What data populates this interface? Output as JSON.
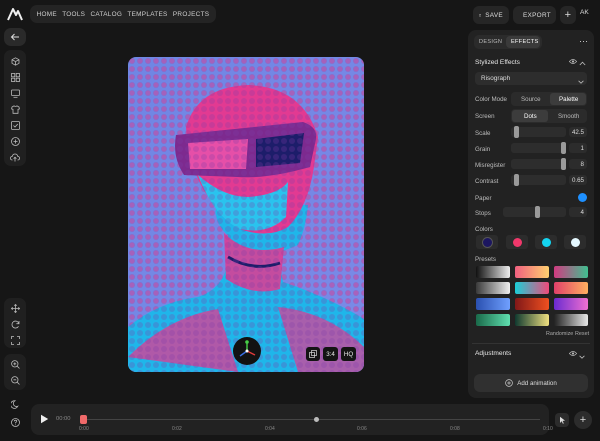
{
  "topbar": {
    "nav": [
      "HOME",
      "TOOLS",
      "CATALOG",
      "TEMPLATES",
      "PROJECTS"
    ],
    "save_label": "SAVE",
    "export_label": "EXPORT",
    "avatar_initials": "AK"
  },
  "canvas": {
    "aspect_label": "3:4",
    "quality_label": "HQ"
  },
  "panel": {
    "tabs": [
      "DESIGN",
      "EFFECTS"
    ],
    "active_tab": "EFFECTS",
    "section_title": "Stylized Effects",
    "effect_select": "Risograph",
    "color_mode": {
      "label": "Color Mode",
      "options": [
        "Source",
        "Palette"
      ],
      "active": "Palette"
    },
    "screen": {
      "label": "Screen",
      "options": [
        "Dots",
        "Smooth"
      ],
      "active": "Dots"
    },
    "sliders": [
      {
        "label": "Scale",
        "value": "42.5",
        "level": 0.05
      },
      {
        "label": "Grain",
        "value": "1",
        "level": 1.0
      },
      {
        "label": "Misregister",
        "value": "8",
        "level": 1.0
      },
      {
        "label": "Contrast",
        "value": "0.65",
        "level": 0.05
      }
    ],
    "paper_label": "Paper",
    "paper_color": "#1e90ff",
    "stops_label": "Stops",
    "stops_value": "4",
    "stops_level": 0.55,
    "colors_label": "Colors",
    "colors": [
      "#1c1660",
      "#f0386b",
      "#14d4f0",
      "#e4f8ff"
    ],
    "presets_label": "Presets",
    "randomize_label": "Randomize",
    "reset_label": "Reset",
    "adjustments_label": "Adjustments",
    "add_animation_label": "Add animation"
  },
  "timeline": {
    "current_time": "00:00",
    "ticks": [
      "0:00",
      "0:02",
      "0:04",
      "0:06",
      "0:08",
      "0:10"
    ]
  }
}
